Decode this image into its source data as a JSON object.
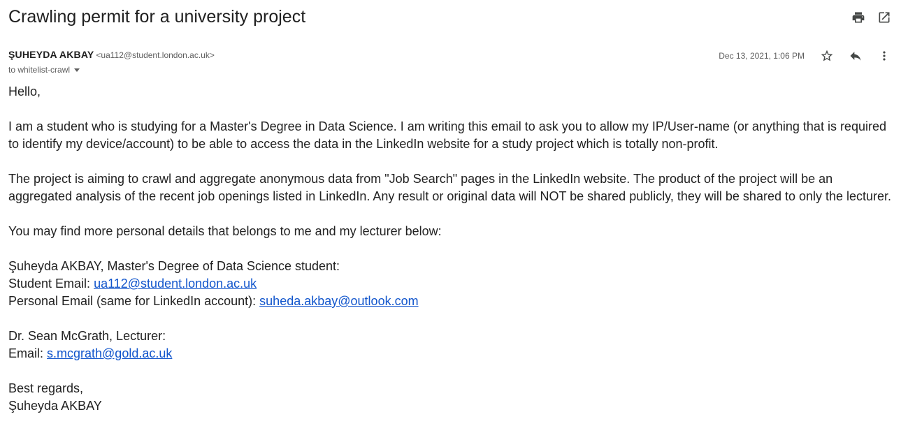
{
  "email": {
    "subject": "Crawling permit for a university project",
    "sender_name": "ŞUHEYDA AKBAY",
    "sender_email": "<ua112@student.london.ac.uk>",
    "to_line": "to whitelist-crawl",
    "date": "Dec 13, 2021, 1:06 PM"
  },
  "icons": {
    "print": "print-icon",
    "open_new_window": "open-in-new-icon",
    "star": "star-icon",
    "reply": "reply-icon",
    "more": "more-vert-icon"
  },
  "body": {
    "greeting": "Hello,",
    "para1": "I am a student who is studying for a Master's Degree in Data Science. I am writing this email to ask you to allow my IP/User-name (or anything that is required to identify my device/account) to be able to access the data in the LinkedIn website for a study project which is totally non-profit.",
    "para2": "The project is aiming to crawl and aggregate anonymous data from \"Job Search\" pages in the LinkedIn website. The product of the project will be an aggregated analysis of the recent job openings listed in LinkedIn. Any result or original data will NOT be shared publicly, they will be shared to only the lecturer.",
    "para3": "You may find more personal details that belongs to me and my lecturer below:",
    "student_line": "Şuheyda AKBAY, Master's Degree of Data Science student:",
    "student_email_label": "Student Email: ",
    "student_email": "ua112@student.london.ac.uk",
    "personal_email_label": "Personal Email (same for LinkedIn account): ",
    "personal_email": "suheda.akbay@outlook.com",
    "lecturer_line": "Dr. Sean McGrath, Lecturer:",
    "lecturer_email_label": "Email: ",
    "lecturer_email": "s.mcgrath@gold.ac.uk",
    "closing": "Best regards,",
    "signature": "Şuheyda AKBAY"
  }
}
